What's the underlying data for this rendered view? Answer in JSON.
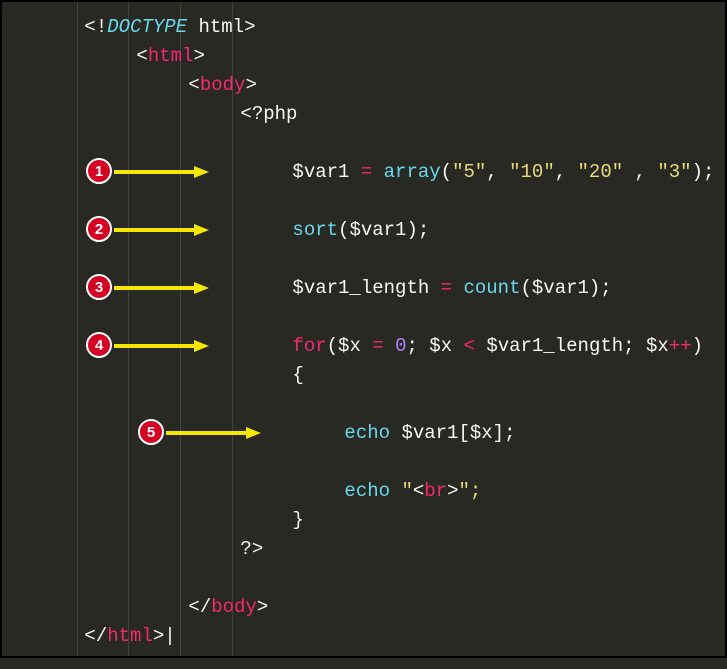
{
  "code": {
    "doctype_open": "<!",
    "doctype_kw": "DOCTYPE",
    "doctype_name": " html",
    "doctype_close": ">",
    "html_open_b1": "<",
    "html_tag": "html",
    "html_open_b2": ">",
    "body_open_b1": "<",
    "body_tag": "body",
    "body_open_b2": ">",
    "php_open": "<?php",
    "line1_var": "$var1",
    "line1_eq": " = ",
    "line1_fn": "array",
    "line1_p1": "(",
    "line1_s1": "\"5\"",
    "line1_c1": ", ",
    "line1_s2": "\"10\"",
    "line1_c2": ", ",
    "line1_s3": "\"20\"",
    "line1_c3": " , ",
    "line1_s4": "\"3\"",
    "line1_p2": ");",
    "line2_fn": "sort",
    "line2_p1": "(",
    "line2_var": "$var1",
    "line2_p2": ");",
    "line3_var": "$var1_length",
    "line3_eq": " = ",
    "line3_fn": "count",
    "line3_p1": "(",
    "line3_arg": "$var1",
    "line3_p2": ");",
    "line4_kw": "for",
    "line4_p1": "(",
    "line4_v1": "$x",
    "line4_eq": " = ",
    "line4_num": "0",
    "line4_sc1": "; ",
    "line4_v2": "$x",
    "line4_lt": " < ",
    "line4_v3": "$var1_length",
    "line4_sc2": "; ",
    "line4_v4": "$x",
    "line4_inc": "++",
    "line4_p2": ")",
    "brace_open": "{",
    "line5_echo": "echo",
    "line5_sp": " ",
    "line5_var": "$var1",
    "line5_br1": "[",
    "line5_idx": "$x",
    "line5_br2": "];",
    "line6_echo": "echo",
    "line6_sp": " ",
    "line6_q1": "\"",
    "line6_br_b1": "<",
    "line6_br_tag": "br",
    "line6_br_b2": ">",
    "line6_q2": "\";",
    "brace_close": "}",
    "php_close": "?>",
    "body_close_b1": "</",
    "body_close_b2": ">",
    "html_close_b1": "</",
    "html_close_b2": ">"
  },
  "badges": {
    "b1": "1",
    "b2": "2",
    "b3": "3",
    "b4": "4",
    "b5": "5"
  },
  "watermark": ""
}
